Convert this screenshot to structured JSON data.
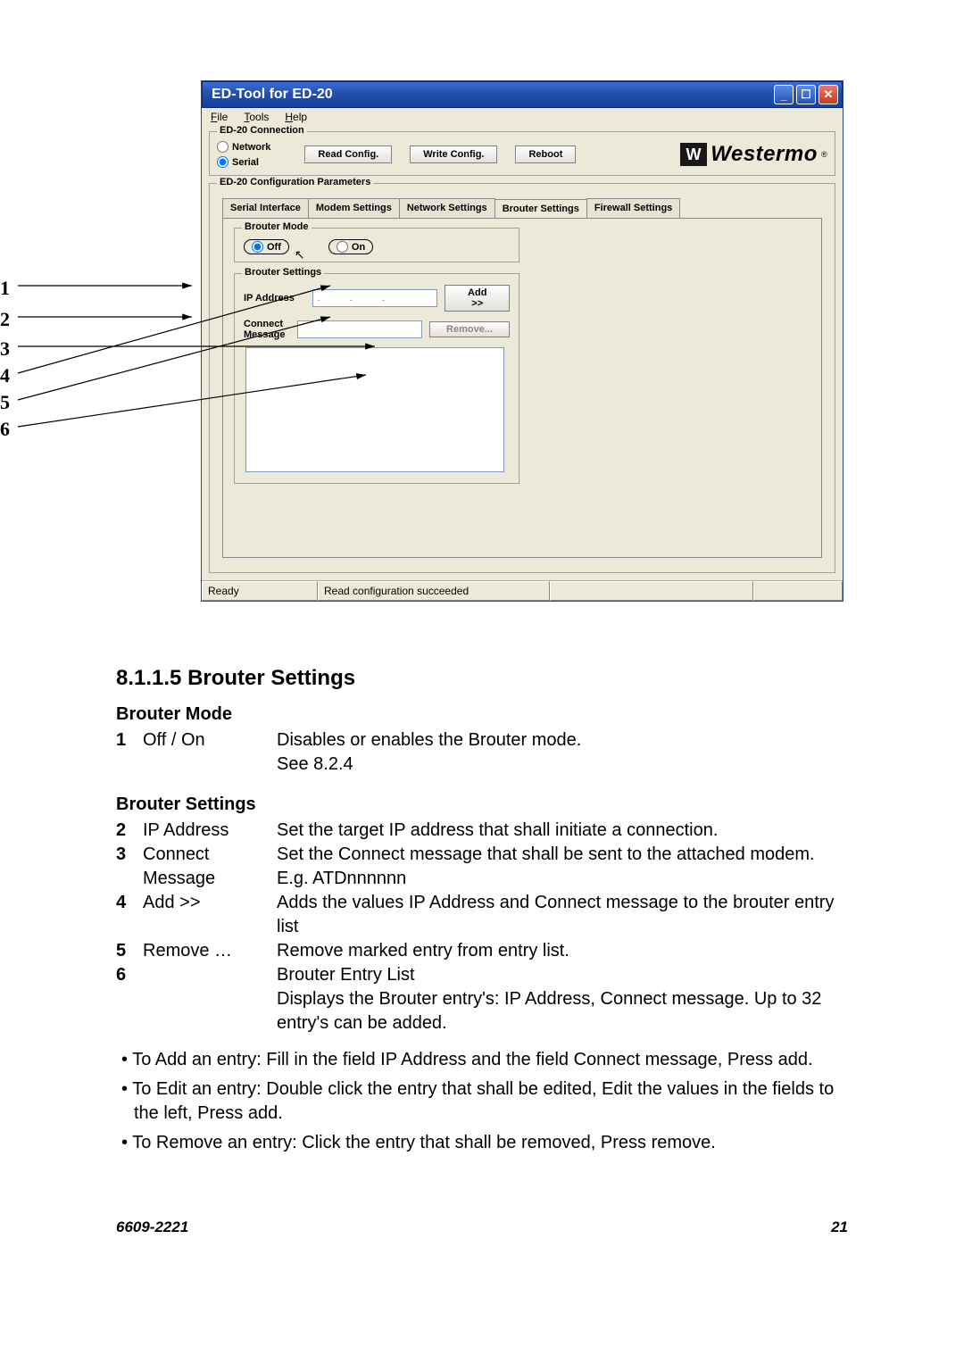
{
  "window": {
    "title": "ED-Tool for ED-20",
    "menu": {
      "file": "File",
      "tools": "Tools",
      "help": "Help"
    },
    "minimize": "_",
    "maximize": "☐",
    "close": "✕"
  },
  "connection": {
    "group_title": "ED-20 Connection",
    "network": "Network",
    "serial": "Serial",
    "read": "Read Config.",
    "write": "Write Config.",
    "reboot": "Reboot"
  },
  "logo": {
    "brand": "Westermo",
    "reg": "®"
  },
  "config": {
    "group_title": "ED-20 Configuration Parameters",
    "tabs": {
      "serial": "Serial Interface",
      "modem": "Modem Settings",
      "network": "Network Settings",
      "brouter": "Brouter Settings",
      "firewall": "Firewall Settings"
    },
    "brouter_mode": {
      "title": "Brouter Mode",
      "off": "Off",
      "on": "On"
    },
    "brouter_settings": {
      "title": "Brouter Settings",
      "ip_label": "IP Address",
      "ip_value": ".   .   .",
      "add": "Add >>",
      "connect_label": "Connect Message",
      "connect_value": "",
      "remove": "Remove..."
    }
  },
  "status": {
    "ready": "Ready",
    "msg": "Read configuration succeeded"
  },
  "callouts": {
    "c1": "1",
    "c2": "2",
    "c3": "3",
    "c4": "4",
    "c5": "5",
    "c6": "6"
  },
  "doc": {
    "heading": "8.1.1.5  Brouter Settings",
    "mode_heading": "Brouter Mode",
    "settings_heading": "Brouter Settings",
    "rows": [
      {
        "n": "1",
        "label": "Off / On",
        "text": "Disables or enables the Brouter mode.\nSee 8.2.4"
      },
      {
        "n": "2",
        "label": "IP Address",
        "text": "Set the target IP address that shall initiate a connection."
      },
      {
        "n": "3",
        "label": "Connect Message",
        "text": "Set the Connect message that shall be sent to the attached modem. E.g. ATDnnnnnn"
      },
      {
        "n": "4",
        "label": "Add >>",
        "text": "Adds the values IP Address and Connect message to the brouter entry list"
      },
      {
        "n": "5",
        "label": "Remove …",
        "text": "Remove marked entry from entry list."
      },
      {
        "n": "6",
        "label": "",
        "text": "Brouter Entry List\nDisplays the Brouter entry's: IP Address, Connect message. Up to 32 entry's can be added."
      }
    ],
    "bullets": [
      "To Add an entry: Fill in the field IP Address and the field Connect message, Press add.",
      "To Edit an entry: Double click the entry that shall be edited, Edit the values in the fields to the left, Press add.",
      "To Remove an entry: Click the entry that shall be removed, Press remove."
    ],
    "footer_left": "6609-2221",
    "footer_right": "21"
  }
}
